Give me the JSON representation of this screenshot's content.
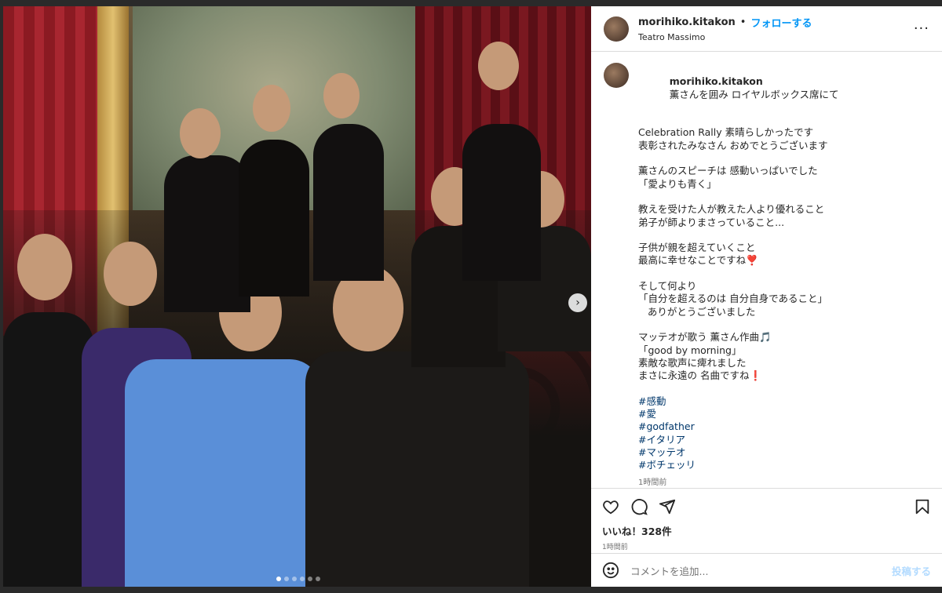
{
  "post": {
    "username": "morihiko.kitakon",
    "separator": "•",
    "follow_label": "フォローする",
    "location": "Teatro Massimo",
    "more_label": "···",
    "next_label": "›",
    "carousel": {
      "total": 6,
      "current": 1
    }
  },
  "caption": {
    "username": "morihiko.kitakon",
    "first_line": "薫さんを囲み ロイヤルボックス席にて",
    "lines": [
      "",
      "Celebration Rally 素晴らしかったです",
      "表彰されたみなさん おめでとうございます",
      "",
      "薫さんのスピーチは 感動いっぱいでした",
      "「愛よりも青く」",
      "",
      "教えを受けた人が教えた人より優れること",
      "弟子が師よりまさっていること...",
      "",
      "子供が親を超えていくこと",
      "最高に幸せなことですね❣️",
      "",
      "そして何より",
      "「自分を超えるのは 自分自身であること」",
      "   ありがとうございました",
      "",
      "マッテオが歌う 薫さん作曲🎵",
      "「good by morning」",
      "素敵な歌声に痺れました",
      "まさに永遠の 名曲ですね❗️",
      ""
    ],
    "hashtags": [
      "#感動",
      "#愛",
      "#godfather",
      "#イタリア",
      "#マッテオ",
      "#ボチェッリ"
    ],
    "time": "1時間前"
  },
  "actions": {
    "likes": "いいね！328件",
    "ago": "1時間前",
    "comment_placeholder": "コメントを追加...",
    "post_label": "投稿する"
  },
  "icons": [
    "heart-icon",
    "comment-icon",
    "share-icon",
    "bookmark-icon",
    "emoji-icon",
    "more-icon"
  ]
}
